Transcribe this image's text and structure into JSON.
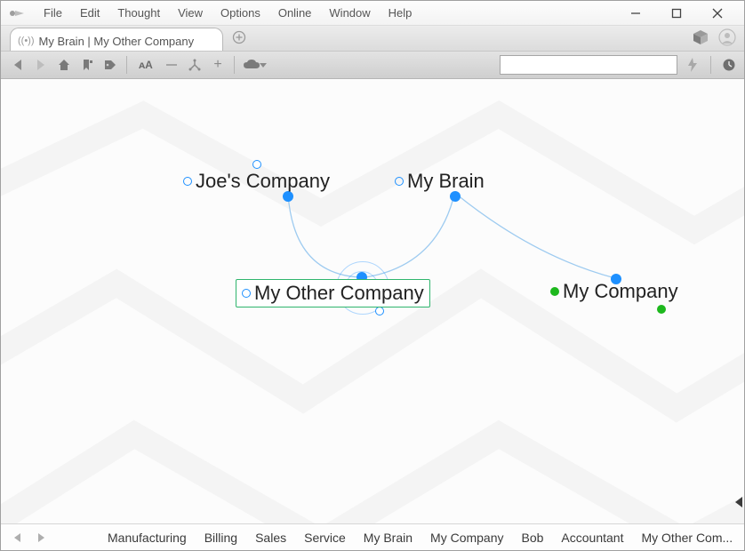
{
  "menu": {
    "items": [
      "File",
      "Edit",
      "Thought",
      "View",
      "Options",
      "Online",
      "Window",
      "Help"
    ]
  },
  "tab": {
    "title": "My Brain | My Other Company"
  },
  "search": {
    "value": ""
  },
  "nodes": {
    "joes": {
      "label": "Joe's Company"
    },
    "mybrain": {
      "label": "My Brain"
    },
    "other": {
      "label": "My Other Company"
    },
    "mycompany": {
      "label": "My Company"
    }
  },
  "footer": {
    "crumbs": [
      "Manufacturing",
      "Billing",
      "Sales",
      "Service",
      "My Brain",
      "My Company",
      "Bob",
      "Accountant",
      "My Other Com..."
    ]
  },
  "colors": {
    "link": "#1e90ff",
    "accent": "#1db81d",
    "active_border": "#2fb56d"
  }
}
